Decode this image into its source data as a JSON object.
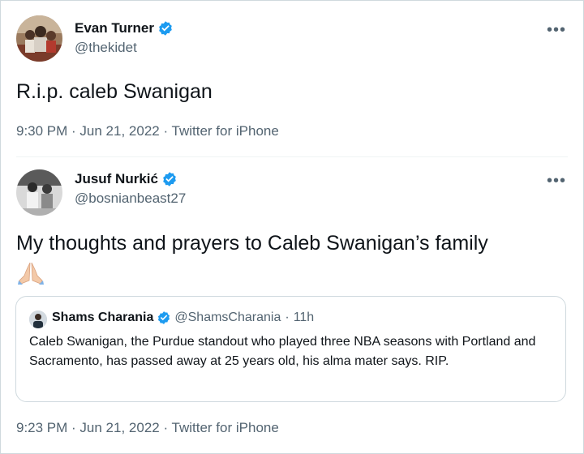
{
  "tweets": [
    {
      "name": "Evan Turner",
      "handle": "@thekidet",
      "text": "R.i.p. caleb Swanigan",
      "meta": "9:30 PM · Jun 21, 2022 · Twitter for iPhone"
    },
    {
      "name": "Jusuf Nurkić",
      "handle": "@bosnianbeast27",
      "text": "My thoughts and prayers to Caleb Swanigan’s family",
      "emoji": "folded-hands",
      "meta": "9:23 PM · Jun 21, 2022 · Twitter for iPhone",
      "quote": {
        "name": "Shams Charania",
        "handle": "@ShamsCharania",
        "separator": "·",
        "time": "11h",
        "text": "Caleb Swanigan, the Purdue standout who played three NBA seasons with Portland and Sacramento, has passed away at 25 years old, his alma mater says. RIP."
      }
    }
  ],
  "more_label": "•••",
  "colors": {
    "verified": "#1d9bf0",
    "secondary_text": "#536471",
    "border": "#cfd9de"
  }
}
